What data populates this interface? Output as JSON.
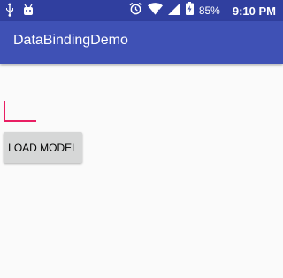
{
  "status_bar": {
    "left_icons": [
      "usb-icon",
      "android-icon"
    ],
    "right_icons": [
      "alarm-icon",
      "wifi-icon",
      "signal-icon",
      "battery-icon"
    ],
    "battery_text": "85%",
    "time": "9:10 PM"
  },
  "app_bar": {
    "title": "DataBindingDemo"
  },
  "edit_text": {
    "value": "",
    "accent_color": "#e91e63"
  },
  "button": {
    "label": "LOAD MODEL"
  },
  "colors": {
    "primary": "#3f51b5",
    "primary_dark": "#303f9f",
    "accent": "#e91e63"
  }
}
